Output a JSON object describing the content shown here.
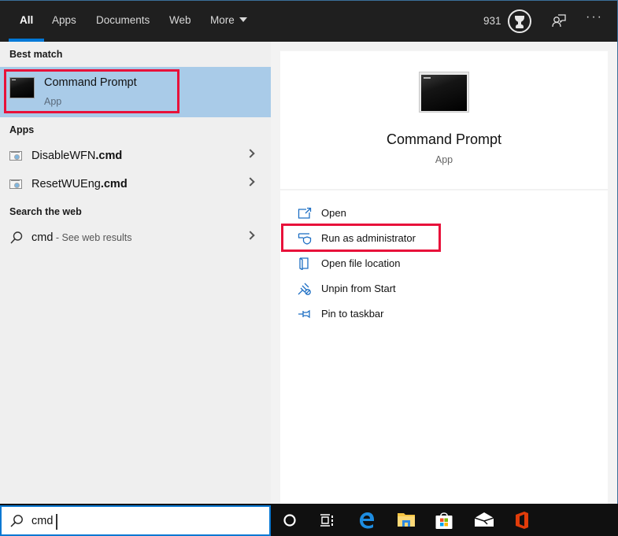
{
  "tabs": [
    {
      "label": "All",
      "active": true
    },
    {
      "label": "Apps",
      "active": false
    },
    {
      "label": "Documents",
      "active": false
    },
    {
      "label": "Web",
      "active": false
    },
    {
      "label": "More",
      "active": false
    }
  ],
  "header": {
    "points": "931",
    "trophy_icon": "trophy-icon",
    "feedback_icon": "feedback-icon",
    "more_options": "···"
  },
  "left_panel": {
    "best_match_heading": "Best match",
    "best_match": {
      "title": "Command Prompt",
      "subtitle": "App",
      "icon": "command-prompt-icon"
    },
    "apps_heading": "Apps",
    "apps": [
      {
        "name": "DisableWFN",
        "ext": ".cmd",
        "icon": "script-file-icon"
      },
      {
        "name": "ResetWUEng",
        "ext": ".cmd",
        "icon": "script-file-icon"
      }
    ],
    "web_heading": "Search the web",
    "web_result": {
      "query": "cmd",
      "suffix": " - See web results",
      "icon": "search-icon"
    }
  },
  "right_panel": {
    "title": "Command Prompt",
    "subtitle": "App",
    "actions": [
      {
        "label": "Open",
        "icon": "open-icon"
      },
      {
        "label": "Run as administrator",
        "icon": "shield-icon"
      },
      {
        "label": "Open file location",
        "icon": "file-location-icon"
      },
      {
        "label": "Unpin from Start",
        "icon": "unpin-icon"
      },
      {
        "label": "Pin to taskbar",
        "icon": "pin-icon"
      }
    ]
  },
  "taskbar": {
    "search_value": "cmd",
    "items": [
      "cortana",
      "task-view",
      "edge",
      "file-explorer",
      "store",
      "mail",
      "office"
    ]
  },
  "colors": {
    "accent": "#0078d7",
    "selection": "#a9cbe8",
    "highlight_box": "#e8113a",
    "icon_blue": "#1e6fc4"
  }
}
